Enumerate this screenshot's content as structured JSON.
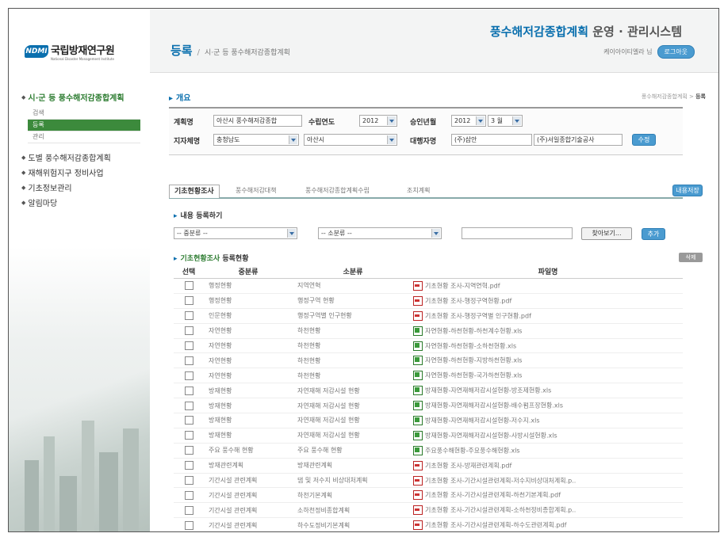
{
  "logo": {
    "brand_mark": "NDMI",
    "name_ko": "국립방재연구원",
    "name_en": "National Disaster Management Institute"
  },
  "sidebar": {
    "items": [
      {
        "label": "시·군 등 풍수해저감종합계획",
        "active": true,
        "sub": [
          "검색",
          "등록",
          "관리"
        ],
        "sub_selected": "등록"
      },
      {
        "label": "도별 풍수해저감종합계획"
      },
      {
        "label": "재해위험지구 정비사업"
      },
      {
        "label": "기초정보관리"
      },
      {
        "label": "알림마당"
      }
    ]
  },
  "header": {
    "page_title": "등록",
    "separator": "/",
    "page_subtitle": "시·군 등 풍수해저감종합계획",
    "system_name_accent": "풍수해저감종합계획",
    "system_name_rest": "운영 · 관리시스템",
    "user_greeting": "케이아이티엘라 님",
    "login_button": "로그아웃"
  },
  "section": {
    "title": "개요",
    "breadcrumb_prefix": "풍수해저감종합계획 >",
    "breadcrumb_current": "등록"
  },
  "form": {
    "plan_name_label": "계획명",
    "plan_name_value": "아산시 풍수해저감종합",
    "year_label": "수립연도",
    "year_value": "2012",
    "approval_label": "승인년월",
    "approval_year": "2012",
    "approval_month": "3 월",
    "region_label": "지자체명",
    "province_value": "충청남도",
    "city_value": "아산시",
    "agency_label": "대행자명",
    "agency_value": "(주)삼안",
    "agency_value2": "(주)서일종합기술공사",
    "edit_button": "수정"
  },
  "tabs": [
    {
      "label": "기초현황조사",
      "active": true
    },
    {
      "label": "풍수해저감대책",
      "active": false
    },
    {
      "label": "풍수해저감종합계획수립",
      "active": false
    },
    {
      "label": "조치계획",
      "active": false
    }
  ],
  "save_button": "내용저장",
  "register": {
    "title": "내용 등록하기",
    "major_select": "-- 중분류 --",
    "minor_select": "-- 소분류 --",
    "browse_button": "찾아보기...",
    "add_button": "추가"
  },
  "list": {
    "title_accent": "기초현황조사",
    "title_rest": "등록현황",
    "delete_button": "삭제",
    "headers": [
      "선택",
      "중분류",
      "소분류",
      "파일명"
    ],
    "rows": [
      {
        "major": "행정현황",
        "minor": "지역연혁",
        "type": "pdf",
        "file": "기초현황 조사-지역연혁.pdf"
      },
      {
        "major": "행정현황",
        "minor": "행정구역 현황",
        "type": "pdf",
        "file": "기초현황 조사-행정구역현황.pdf"
      },
      {
        "major": "인문현황",
        "minor": "행정구역별 인구현황",
        "type": "pdf",
        "file": "기초현황 조사-행정구역별 인구현황.pdf"
      },
      {
        "major": "자연현황",
        "minor": "하천현황",
        "type": "xls",
        "file": "자연현황-하천현황-하천계수현황.xls"
      },
      {
        "major": "자연현황",
        "minor": "하천현황",
        "type": "xls",
        "file": "자연현황-하천현황-소하천현황.xls"
      },
      {
        "major": "자연현황",
        "minor": "하천현황",
        "type": "xls",
        "file": "자연현황-하천현황-지방하천현황.xls"
      },
      {
        "major": "자연현황",
        "minor": "하천현황",
        "type": "xls",
        "file": "자연현황-하천현황-국가하천현황.xls"
      },
      {
        "major": "방재현황",
        "minor": "자연재해 저감시설 현황",
        "type": "xls",
        "file": "방재현황-자연재해저감시설현황-방조제현황.xls"
      },
      {
        "major": "방재현황",
        "minor": "자연재해 저감시설 현황",
        "type": "xls",
        "file": "방재현황-자연재해저감시설현황-배수펌프장현황.xls"
      },
      {
        "major": "방재현황",
        "minor": "자연재해 저감시설 현황",
        "type": "xls",
        "file": "방재현황-자연재해저감시설현황-저수지.xls"
      },
      {
        "major": "방재현황",
        "minor": "자연재해 저감시설 현황",
        "type": "xls",
        "file": "방재현황-자연재해저감시설현황-사방시설현황.xls"
      },
      {
        "major": "주요 풍수해 현황",
        "minor": "주요 풍수해 현황",
        "type": "xls",
        "file": "주요풍수해현황-주요풍수해현황.xls"
      },
      {
        "major": "방재관련계획",
        "minor": "방재관련계획",
        "type": "pdf",
        "file": "기초현황 조사-방재관련계획.pdf"
      },
      {
        "major": "기간시설 관련계획",
        "minor": "댐 및 저수지 비상대처계획",
        "type": "pdf",
        "file": "기초현황 조사-기간시설관련계획-저수지비상대처계획.p.."
      },
      {
        "major": "기간시설 관련계획",
        "minor": "하천기본계획",
        "type": "pdf",
        "file": "기초현황 조사-기간시설관련계획-하천기본계획.pdf"
      },
      {
        "major": "기간시설 관련계획",
        "minor": "소하천정비종합계획",
        "type": "pdf",
        "file": "기초현황 조사-기간시설관련계획-소하천정비종합계획.p.."
      },
      {
        "major": "기간시설 관련계획",
        "minor": "하수도정비기본계획",
        "type": "pdf",
        "file": "기초현황 조사-기간시설관련계획-하수도관련계획.pdf"
      }
    ]
  }
}
